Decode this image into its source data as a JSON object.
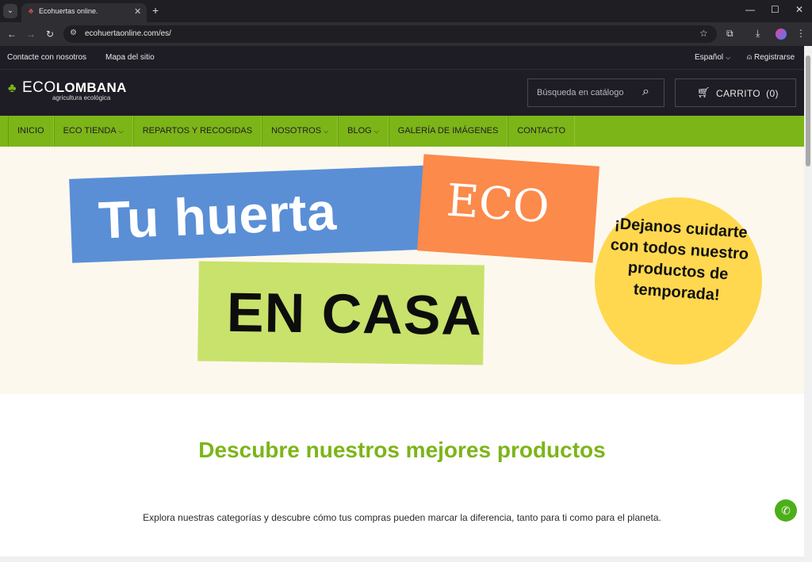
{
  "browser": {
    "tab_title": "Ecohuertas online.",
    "url": "ecohuertaonline.com/es/",
    "icons": {
      "tab_menu": "chevron-down-icon",
      "favicon": "leaf-icon",
      "close": "close-icon",
      "new_tab": "plus-icon",
      "back": "arrow-left-icon",
      "forward": "arrow-right-icon",
      "reload": "reload-icon",
      "site_info": "tune-icon",
      "bookmark": "star-icon",
      "extensions": "puzzle-icon",
      "download": "download-icon",
      "menu": "kebab-icon"
    }
  },
  "topbar": {
    "contact": "Contacte con nosotros",
    "sitemap": "Mapa del sitio",
    "language": "Español",
    "register": "Registrarse"
  },
  "header": {
    "logo_eco": "ECO",
    "logo_lombana": "LOMBANA",
    "logo_sub": "agricultura ecológica",
    "search_placeholder": "Búsqueda en catálogo",
    "cart_label": "CARRITO",
    "cart_count": "(0)"
  },
  "nav": {
    "items": [
      {
        "label": "INICIO",
        "dropdown": false
      },
      {
        "label": "ECO TIENDA",
        "dropdown": true
      },
      {
        "label": "REPARTOS Y RECOGIDAS",
        "dropdown": false
      },
      {
        "label": "NOSOTROS",
        "dropdown": true
      },
      {
        "label": "BLOG",
        "dropdown": true
      },
      {
        "label": "GALERÍA DE IMÁGENES",
        "dropdown": false
      },
      {
        "label": "CONTACTO",
        "dropdown": false
      }
    ]
  },
  "hero": {
    "line1": "Tu huerta",
    "badge": "ECO",
    "line2": "EN CASA",
    "circle_text": "¡Dejanos cuidarte con todos nuestro productos de temporada!",
    "colors": {
      "blue": "#5a8fd6",
      "orange": "#fb8a4b",
      "green": "#c8e26c",
      "yellow": "#ffd84f",
      "background": "#fdf8ee"
    }
  },
  "section": {
    "title": "Descubre nuestros mejores productos",
    "description": "Explora nuestras categorías y descubre cómo tus compras pueden marcar la diferencia, tanto para ti como para el planeta."
  },
  "colors": {
    "brand_green": "#7cb518",
    "dark": "#1e1c24"
  }
}
